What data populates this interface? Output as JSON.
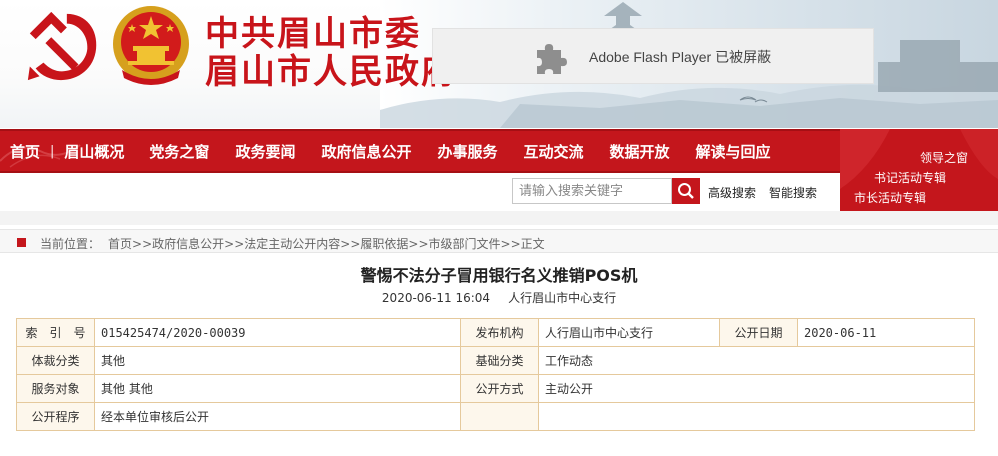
{
  "header": {
    "title_line1": "中共眉山市委",
    "title_line2": "眉山市人民政府",
    "flash_message": "Adobe Flash Player 已被屏蔽"
  },
  "colors": {
    "brand_red": "#c4161c",
    "table_border": "#e5c99c",
    "table_key_bg": "#fdf7ec"
  },
  "nav": {
    "items": [
      {
        "label": "首页"
      },
      {
        "label": "眉山概况"
      },
      {
        "label": "党务之窗"
      },
      {
        "label": "政务要闻"
      },
      {
        "label": "政府信息公开"
      },
      {
        "label": "办事服务"
      },
      {
        "label": "互动交流"
      },
      {
        "label": "数据开放"
      },
      {
        "label": "解读与回应"
      }
    ]
  },
  "leaders": {
    "link1": "领导之窗",
    "link2": "书记活动专辑",
    "link3": "市长活动专辑"
  },
  "search": {
    "placeholder": "请输入搜索关键字",
    "advanced_label": "高级搜索",
    "smart_label": "智能搜索"
  },
  "breadcrumb": {
    "label": "当前位置：",
    "items": [
      "首页",
      "政府信息公开",
      "法定主动公开内容",
      "履职依据",
      "市级部门文件",
      "正文"
    ],
    "separator": ">>"
  },
  "article": {
    "title": "警惕不法分子冒用银行名义推销POS机",
    "datetime": "2020-06-11 16:04",
    "source": "人行眉山市中心支行"
  },
  "info": {
    "index_label": "索　引　号",
    "index_value": "015425474/2020-00039",
    "publisher_label": "发布机构",
    "publisher_value": "人行眉山市中心支行",
    "pubdate_label": "公开日期",
    "pubdate_value": "2020-06-11",
    "genre_label": "体裁分类",
    "genre_value": "其他",
    "basic_label": "基础分类",
    "basic_value": "工作动态",
    "audience_label": "服务对象",
    "audience_value": "其他 其他",
    "mode_label": "公开方式",
    "mode_value": "主动公开",
    "procedure_label": "公开程序",
    "procedure_value": "经本单位审核后公开"
  }
}
